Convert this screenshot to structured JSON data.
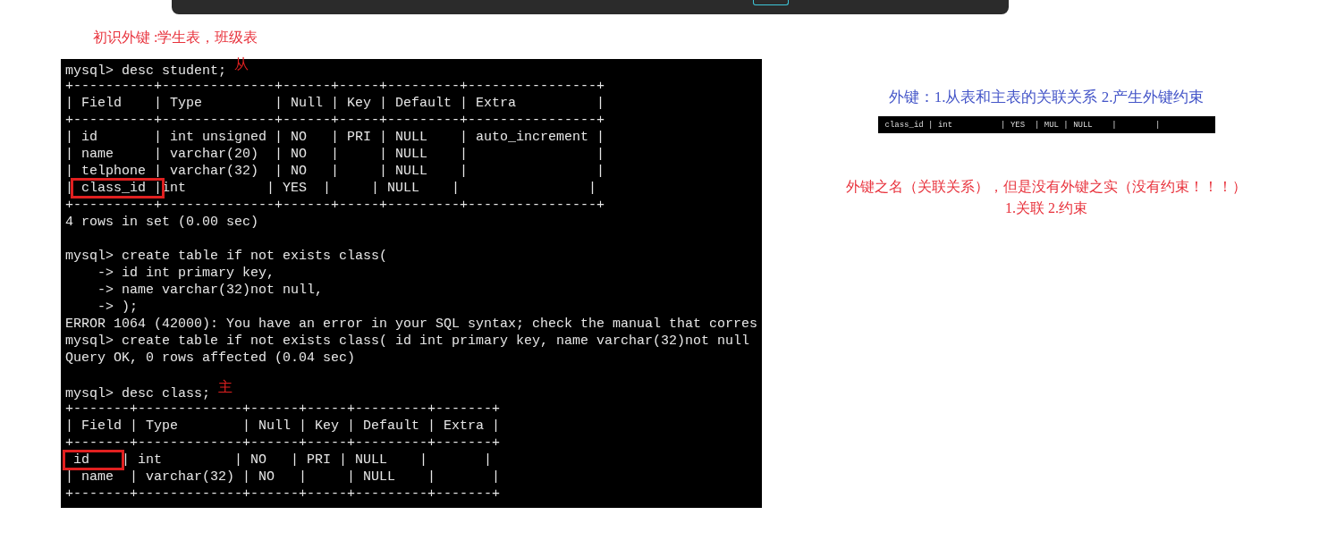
{
  "heading": "初识外键 :学生表，班级表",
  "terminal": {
    "lines": [
      {
        "segments": [
          {
            "text": "mysql> desc student; ",
            "boxed": false
          }
        ],
        "note": "从"
      },
      {
        "segments": [
          {
            "text": "+----------+--------------+------+-----+---------+----------------+",
            "boxed": false
          }
        ]
      },
      {
        "segments": [
          {
            "text": "| Field    | Type         | Null | Key | Default | Extra          |",
            "boxed": false
          }
        ]
      },
      {
        "segments": [
          {
            "text": "+----------+--------------+------+-----+---------+----------------+",
            "boxed": false
          }
        ]
      },
      {
        "segments": [
          {
            "text": "| id       | int unsigned | NO   | PRI | NULL    | auto_increment |",
            "boxed": false
          }
        ]
      },
      {
        "segments": [
          {
            "text": "| name     | varchar(20)  | NO   |     | NULL    |                |",
            "boxed": false
          }
        ]
      },
      {
        "segments": [
          {
            "text": "| telphone | varchar(32)  | NO   |     | NULL    |                |",
            "boxed": false
          }
        ]
      },
      {
        "segments": [
          {
            "text": "|",
            "boxed": false
          },
          {
            "text": " class_id |",
            "boxed": true
          },
          {
            "text": "int          | YES  |     | NULL    |                |",
            "boxed": false
          }
        ]
      },
      {
        "segments": [
          {
            "text": "+----------+--------------+------+-----+---------+----------------+",
            "boxed": false
          }
        ]
      },
      {
        "segments": [
          {
            "text": "4 rows in set (0.00 sec)",
            "boxed": false
          }
        ]
      },
      {
        "gap_before": true,
        "segments": [
          {
            "text": "mysql> create table if not exists class(",
            "boxed": false
          }
        ]
      },
      {
        "segments": [
          {
            "text": "    -> id int primary key,",
            "boxed": false
          }
        ]
      },
      {
        "segments": [
          {
            "text": "    -> name varchar(32)not null,",
            "boxed": false
          }
        ]
      },
      {
        "segments": [
          {
            "text": "    -> );",
            "boxed": false
          }
        ]
      },
      {
        "segments": [
          {
            "text": "ERROR 1064 (42000): You have an error in your SQL syntax; check the manual that corres",
            "boxed": false
          }
        ]
      },
      {
        "segments": [
          {
            "text": "mysql> create table if not exists class( id int primary key, name varchar(32)not null",
            "boxed": false
          }
        ]
      },
      {
        "segments": [
          {
            "text": "Query OK, 0 rows affected (0.04 sec)",
            "boxed": false
          }
        ]
      },
      {
        "gap_before": true,
        "segments": [
          {
            "text": "mysql> desc class; ",
            "boxed": false
          }
        ],
        "note": "主"
      },
      {
        "segments": [
          {
            "text": "+-------+-------------+------+-----+---------+-------+",
            "boxed": false
          }
        ]
      },
      {
        "segments": [
          {
            "text": "| Field | Type        | Null | Key | Default | Extra |",
            "boxed": false
          }
        ]
      },
      {
        "segments": [
          {
            "text": "+-------+-------------+------+-----+---------+-------+",
            "boxed": false
          }
        ]
      },
      {
        "segments": [
          {
            "text": " id    ",
            "boxed": true
          },
          {
            "text": "| int         | NO   | PRI | NULL    |       |",
            "boxed": false
          }
        ]
      },
      {
        "segments": [
          {
            "text": "| name  | varchar(32) | NO   |     | NULL    |       |",
            "boxed": false
          }
        ]
      },
      {
        "segments": [
          {
            "text": "+-------+-------------+------+-----+---------+-------+",
            "boxed": false
          }
        ]
      }
    ]
  },
  "right": {
    "definition": "外键：1.从表和主表的关联关系 2.产生外键约束",
    "strip_line": "class_id | int          | YES  | MUL | NULL    |        |",
    "remarks": [
      "外键之名（关联关系），但是没有外键之实（没有约束！！！）",
      "1.关联 2.约束"
    ]
  }
}
